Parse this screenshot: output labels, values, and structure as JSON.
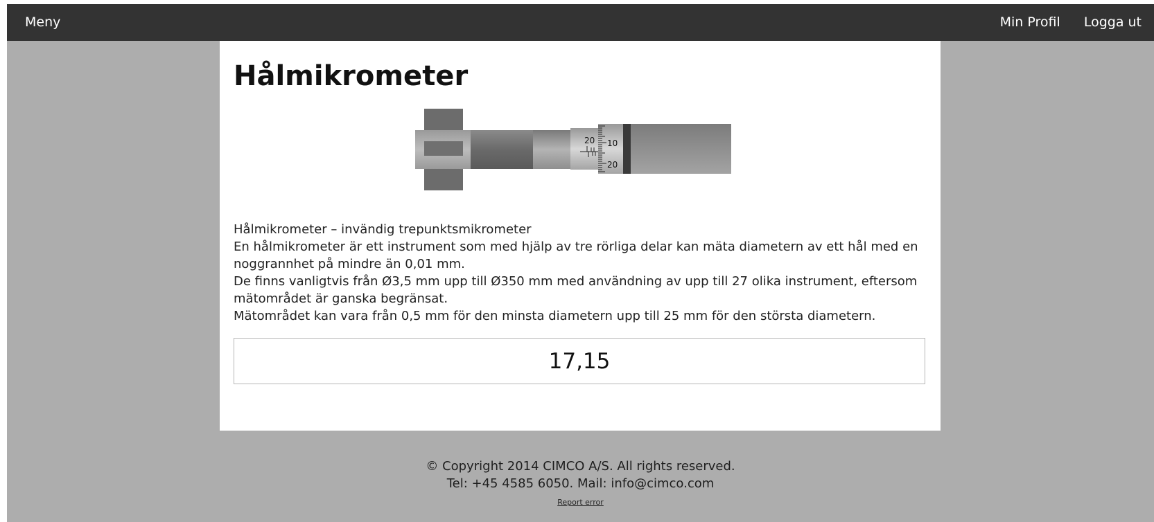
{
  "nav": {
    "menu_label": "Meny",
    "profile_label": "Min Profil",
    "logout_label": "Logga ut"
  },
  "page": {
    "title": "Hålmikrometer"
  },
  "illustration": {
    "icon": "bore-micrometer-illustration",
    "scale_labels": {
      "sleeve": "20",
      "thimble_upper": "10",
      "thimble_lower": "20"
    }
  },
  "description": {
    "lines": [
      "Hålmikrometer – invändig trepunktsmikrometer",
      "En hålmikrometer är ett instrument som med hjälp av tre rörliga delar kan mäta diametern av ett hål med en noggrannhet på mindre än 0,01 mm.",
      "De finns vanligtvis från Ø3,5 mm upp till Ø350 mm med användning av upp till 27 olika instrument, eftersom mätområdet är ganska begränsat.",
      "Mätområdet kan vara från 0,5 mm för den minsta diametern upp till 25 mm för den största diametern."
    ]
  },
  "reading": {
    "value": "17,15"
  },
  "footer": {
    "copyright": "© Copyright 2014 CIMCO A/S. All rights reserved.",
    "contact": "Tel: +45 4585 6050. Mail: info@cimco.com",
    "report_link": "Report error"
  },
  "colors": {
    "navbar": "#333333",
    "background": "#adadad",
    "card": "#ffffff"
  }
}
